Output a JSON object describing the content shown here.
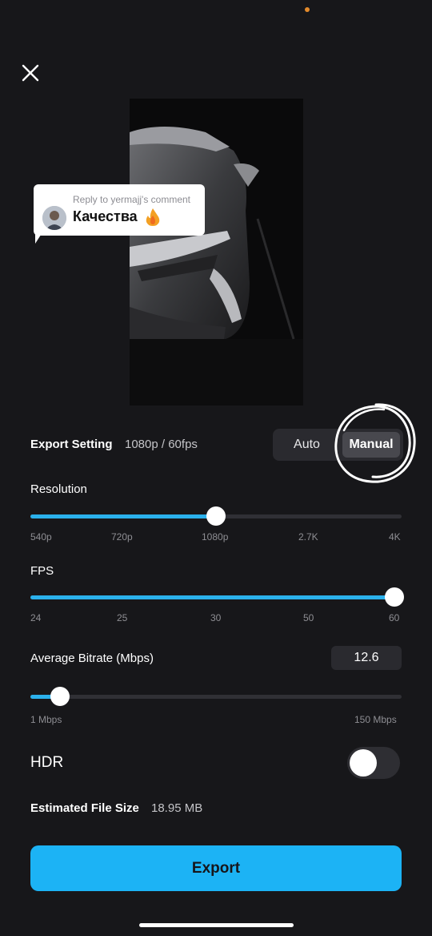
{
  "comment": {
    "reply_label": "Reply to yermajj's comment",
    "text": "Качества",
    "emoji": "🔥"
  },
  "export_setting": {
    "label": "Export Setting",
    "value": "1080p / 60fps",
    "modes": [
      "Auto",
      "Manual"
    ],
    "selected_mode": "Manual"
  },
  "resolution": {
    "label": "Resolution",
    "ticks": [
      "540p",
      "720p",
      "1080p",
      "2.7K",
      "4K"
    ],
    "selected": "1080p",
    "fraction": 0.5
  },
  "fps": {
    "label": "FPS",
    "ticks": [
      "24",
      "25",
      "30",
      "50",
      "60"
    ],
    "selected": "60",
    "fraction": 1.0
  },
  "bitrate": {
    "label": "Average Bitrate (Mbps)",
    "value": "12.6",
    "min_label": "1 Mbps",
    "max_label": "150 Mbps",
    "fraction": 0.08
  },
  "hdr": {
    "label": "HDR",
    "enabled": false
  },
  "file_size": {
    "label": "Estimated File Size",
    "value": "18.95 MB"
  },
  "export_button": "Export",
  "colors": {
    "accent": "#2bb1ec",
    "export_button": "#1cb3f5",
    "background": "#17171a"
  }
}
